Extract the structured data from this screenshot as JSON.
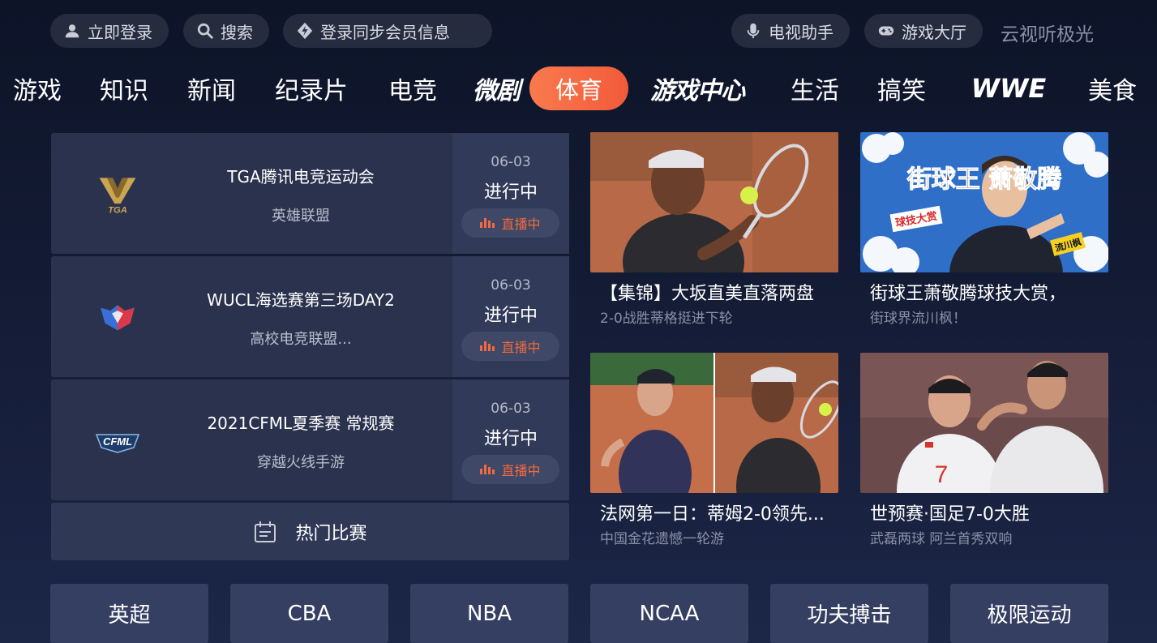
{
  "topbar": {
    "login": "立即登录",
    "search": "搜索",
    "sync": "登录同步会员信息",
    "tv_assistant": "电视助手",
    "game_hall": "游戏大厅",
    "brand": "云视听极光"
  },
  "nav": {
    "items": [
      "游戏",
      "知识",
      "新闻",
      "纪录片",
      "电竞",
      "微剧",
      "体育",
      "游戏中心",
      "生活",
      "搞笑",
      "WWE",
      "美食"
    ],
    "active": "体育"
  },
  "matches": [
    {
      "name": "TGA腾讯电竞运动会",
      "sub": "英雄联盟",
      "date": "06-03",
      "status": "进行中",
      "live": "直播中",
      "logo_text": "TGA"
    },
    {
      "name": "WUCL海选赛第三场DAY2",
      "sub": "高校电竞联盟...",
      "date": "06-03",
      "status": "进行中",
      "live": "直播中"
    },
    {
      "name": "2021CFML夏季赛 常规赛",
      "sub": "穿越火线手游",
      "date": "06-03",
      "status": "进行中",
      "live": "直播中",
      "logo_text": "CFML"
    }
  ],
  "hot_matches": "热门比赛",
  "cards": [
    {
      "title": "【集锦】大坂直美直落两盘",
      "desc": "2-0战胜蒂格挺进下轮"
    },
    {
      "title": "街球王萧敬腾球技大赏，",
      "desc": "街球界流川枫！",
      "thumb_text": "街球王 萧敬腾",
      "thumb_tag": "球技大赏",
      "thumb_tag2": "流川枫"
    },
    {
      "title": "法网第一日：蒂姆2-0领先...",
      "desc": "中国金花遗憾一轮游"
    },
    {
      "title": "世预赛·国足7-0大胜",
      "desc": "武磊两球 阿兰首秀双响"
    }
  ],
  "categories": [
    "英超",
    "CBA",
    "NBA",
    "NCAA",
    "功夫搏击",
    "极限运动"
  ],
  "colors": {
    "accent": "#f25a3a",
    "live": "#f26a3e",
    "bg": "#151d38"
  }
}
